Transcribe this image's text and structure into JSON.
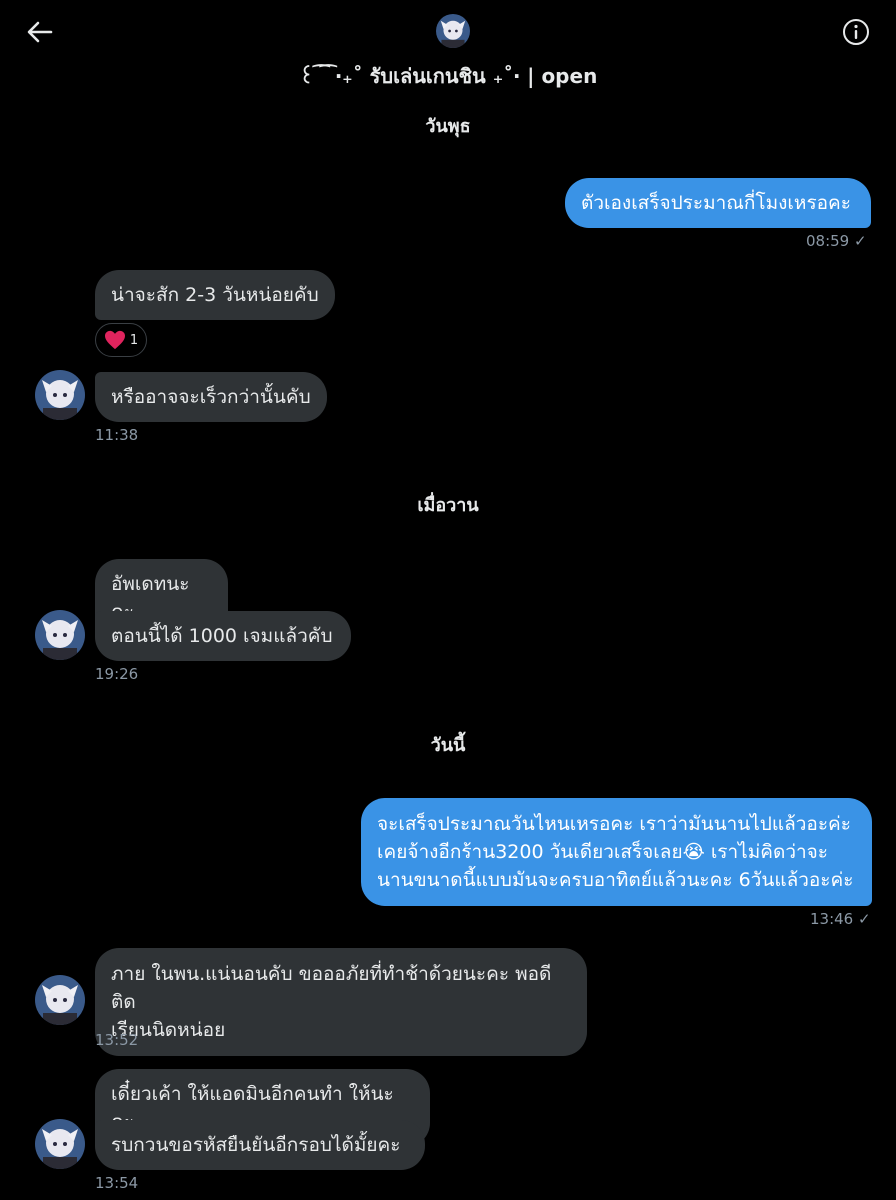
{
  "header": {
    "title": "꒰ ͡ ͡ ‧₊˚ รับเล่นเกนชิน ₊˚‧ | open"
  },
  "days": {
    "wednesday": "วันพุธ",
    "yesterday": "เมื่อวาน",
    "today": "วันนี้"
  },
  "messages": [
    {
      "text": "ตัวเองเสร็จประมาณกี่โมงเหรอคะ",
      "time": "08:59"
    },
    {
      "text": "น่าจะสัก 2-3 วันหน่อยคับ"
    },
    {
      "text": "หรืออาจจะเร็วกว่านั้นคับ",
      "time": "11:38"
    },
    {
      "text": "อัพเดทนะคะ"
    },
    {
      "text": "ตอนนี้ได้ 1000 เจมแล้วคับ",
      "time": "19:26"
    },
    {
      "lines": [
        "จะเสร็จประมาณวันไหนเหรอคะ เราว่ามันนานไปแล้วอะค่ะ",
        "เคยจ้างอีกร้าน3200 วันเดียวเสร็จเลย😭 เราไม่คิดว่าจะ",
        "นานขนาดนี้แบบมันจะครบอาทิตย์แล้วนะคะ 6วันแล้วอะค่ะ"
      ],
      "time": "13:46"
    },
    {
      "lines": [
        "ภาย ในพน.แน่นอนคับ ขอออภัยที่ทำช้าด้วยนะคะ พอดีติด",
        "เรียนนิดหน่อย"
      ],
      "time": "13:52"
    },
    {
      "text": "เดี๋ยวเค้า ให้แอดมินอีกคนทำ ให้นะคะ"
    },
    {
      "text": "รบกวนขอรหัสยืนยันอีกรอบได้มั้ยคะ",
      "time": "13:54"
    }
  ],
  "reaction": {
    "icon": "heart-icon",
    "count": "1"
  },
  "colors": {
    "background": "#000000",
    "incoming_bubble": "#2f3336",
    "outgoing_bubble": "#3a93e6",
    "meta_text": "#8b98a5"
  }
}
